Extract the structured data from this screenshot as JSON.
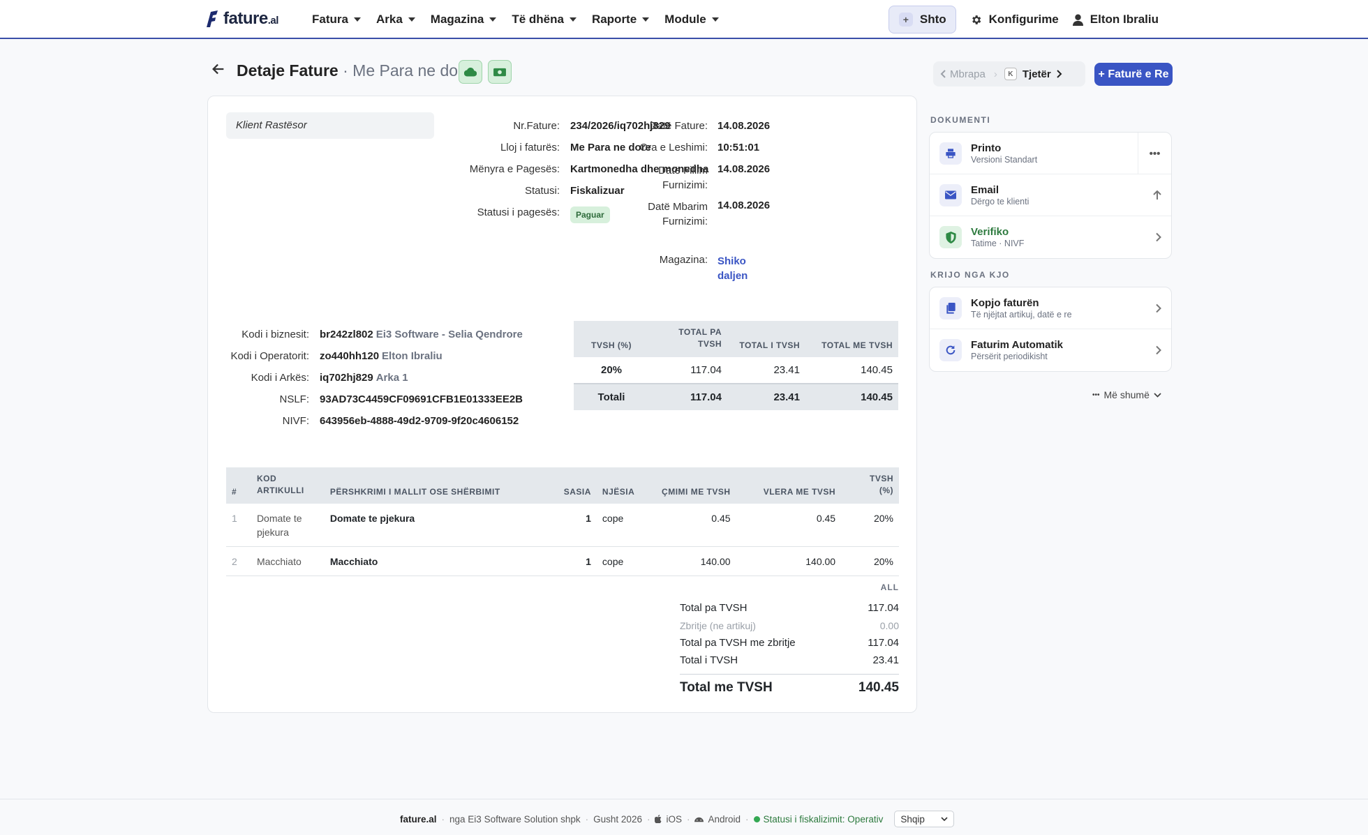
{
  "navbar": {
    "logo_text": "fature",
    "logo_suffix": ".al",
    "menu": [
      {
        "label": "Fatura"
      },
      {
        "label": "Arka"
      },
      {
        "label": "Magazina"
      },
      {
        "label": "Të dhëna"
      },
      {
        "label": "Raporte"
      },
      {
        "label": "Module"
      }
    ],
    "add_button": "Shto",
    "settings_link": "Konfigurime",
    "user_name": "Elton Ibraliu"
  },
  "header": {
    "title": "Detaje Fature",
    "subtitle": "· Me Para ne dore",
    "prev_label": "Mbrapa",
    "kbd_hint": "K",
    "next_label": "Tjetër",
    "new_invoice_button": "+ Faturë e Re",
    "chip_colors": {
      "cloud": "#2e8a45",
      "cash": "#2e8a45"
    }
  },
  "invoice": {
    "client": "Klient Rastësor",
    "fields_middle": [
      {
        "label": "Nr.Fature:",
        "value": "234/2026/iq702hj829"
      },
      {
        "label": "Lloj i faturës:",
        "value": "Me Para ne dore"
      },
      {
        "label": "Mënyra e Pagesës:",
        "value": "Kartmonedha dhe monedha"
      },
      {
        "label": "Statusi:",
        "value": "Fiskalizuar"
      },
      {
        "label": "Statusi i pagesës:",
        "value": "Paguar"
      }
    ],
    "fields_right": {
      "date_label": "Datë Fature:",
      "date_value": "14.08.2026",
      "time_label": "Ora e Leshimi:",
      "time_value": "10:51:01",
      "supply_start_label_1": "Datë Fillim",
      "supply_start_label_2": "Furnizimi:",
      "supply_start_value": "14.08.2026",
      "supply_end_label_1": "Datë Mbarim",
      "supply_end_label_2": "Furnizimi:",
      "supply_end_value": "14.08.2026",
      "warehouse_label": "Magazina:",
      "warehouse_link_1": "Shiko",
      "warehouse_link_2": "daljen"
    },
    "codes": [
      {
        "label": "Kodi i biznesit:",
        "value": "br242zl802",
        "extra": "Ei3 Software - Selia Qendrore"
      },
      {
        "label": "Kodi i Operatorit:",
        "value": "zo440hh120",
        "extra": "Elton Ibraliu"
      },
      {
        "label": "Kodi i Arkës:",
        "value": "iq702hj829",
        "extra": "Arka 1"
      },
      {
        "label": "NSLF:",
        "value": "93AD73C4459CF09691CFB1E01333EE2B",
        "extra": ""
      },
      {
        "label": "NIVF:",
        "value": "643956eb-4888-49d2-9709-9f20c4606152",
        "extra": ""
      }
    ],
    "vat_table": {
      "headers": [
        "TVSH (%)",
        "TOTAL PA TVSH",
        "TOTAL I TVSH",
        "TOTAL ME TVSH"
      ],
      "header_1a": "TOTAL PA",
      "header_1b": "TVSH",
      "rows": [
        [
          "20%",
          "117.04",
          "23.41",
          "140.45"
        ]
      ],
      "total": [
        "Totali",
        "117.04",
        "23.41",
        "140.45"
      ]
    },
    "items_table": {
      "headers": {
        "num": "#",
        "code_1": "KOD",
        "code_2": "ARTIKULLI",
        "desc": "PËRSHKRIMI I MALLIT OSE SHËRBIMIT",
        "qty": "SASIA",
        "unit": "NJËSIA",
        "price": "ÇMIMI ME TVSH",
        "value": "VLERA ME TVSH",
        "vat_1": "TVSH",
        "vat_2": "(%)"
      },
      "rows": [
        {
          "num": "1",
          "code_1": "Domate te",
          "code_2": "pjekura",
          "desc": "Domate te pjekura",
          "qty": "1",
          "unit": "cope",
          "price": "0.45",
          "value": "0.45",
          "vat": "20%"
        },
        {
          "num": "2",
          "code_1": "Macchiato",
          "code_2": "",
          "desc": "Macchiato",
          "qty": "1",
          "unit": "cope",
          "price": "140.00",
          "value": "140.00",
          "vat": "20%"
        }
      ]
    },
    "totals": {
      "currency": "ALL",
      "rows": [
        {
          "label": "Total pa TVSH",
          "value": "117.04"
        },
        {
          "label": "Zbritje (ne artikuj)",
          "value": "0.00"
        },
        {
          "label": "Total pa TVSH me zbritje",
          "value": "117.04"
        },
        {
          "label": "Total i TVSH",
          "value": "23.41"
        }
      ],
      "grand_label": "Total me TVSH",
      "grand_value": "140.45"
    }
  },
  "sidebar": {
    "document_title": "DOKUMENTI",
    "document_actions": [
      {
        "title": "Printo",
        "sub": "Versioni Standart",
        "more": "•••"
      },
      {
        "title": "Email",
        "sub": "Dërgo te klienti"
      },
      {
        "title": "Verifiko",
        "sub": "Tatime · NIVF"
      }
    ],
    "create_title": "KRIJO NGA KJO",
    "create_actions": [
      {
        "title": "Kopjo faturën",
        "sub": "Të njëjtat artikuj, datë e re"
      },
      {
        "title": "Faturim Automatik",
        "sub": "Përsërit periodikisht"
      }
    ],
    "more_label": "Më shumë",
    "more_dots": "•••"
  },
  "footer": {
    "brand": "fature.al",
    "company": "nga Ei3 Software Solution shpk",
    "date": "Gusht 2026",
    "ios": "iOS",
    "android": "Android",
    "fiscal_status": "Statusi i fiskalizimit: Operativ",
    "language": "Shqip"
  },
  "colors": {
    "accent": "#3a55c4",
    "success": "#2e8a45",
    "nav_border": "#3a4ea8"
  }
}
